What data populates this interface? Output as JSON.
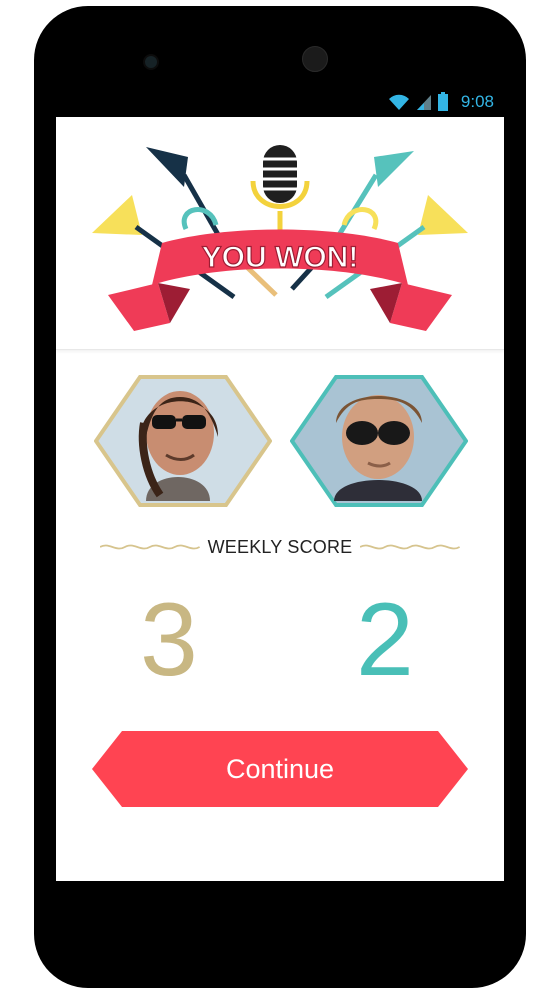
{
  "status_bar": {
    "time": "9:08",
    "icons": [
      "wifi-icon",
      "signal-icon",
      "battery-icon"
    ],
    "accent_color": "#33b5e5"
  },
  "banner": {
    "text": "YOU WON!",
    "ribbon_color": "#ef3b57",
    "icons": [
      "microphone-icon",
      "trumpet-icon",
      "trumpet-icon"
    ]
  },
  "players": [
    {
      "name": "player-left",
      "border_color": "#d8c58c"
    },
    {
      "name": "player-right",
      "border_color": "#4dbfb8"
    }
  ],
  "weekly_score": {
    "label": "WEEKLY SCORE",
    "left_score": "3",
    "right_score": "2",
    "left_color": "#c8b783",
    "right_color": "#49bfb7"
  },
  "continue": {
    "label": "Continue",
    "color": "#ff4452"
  }
}
